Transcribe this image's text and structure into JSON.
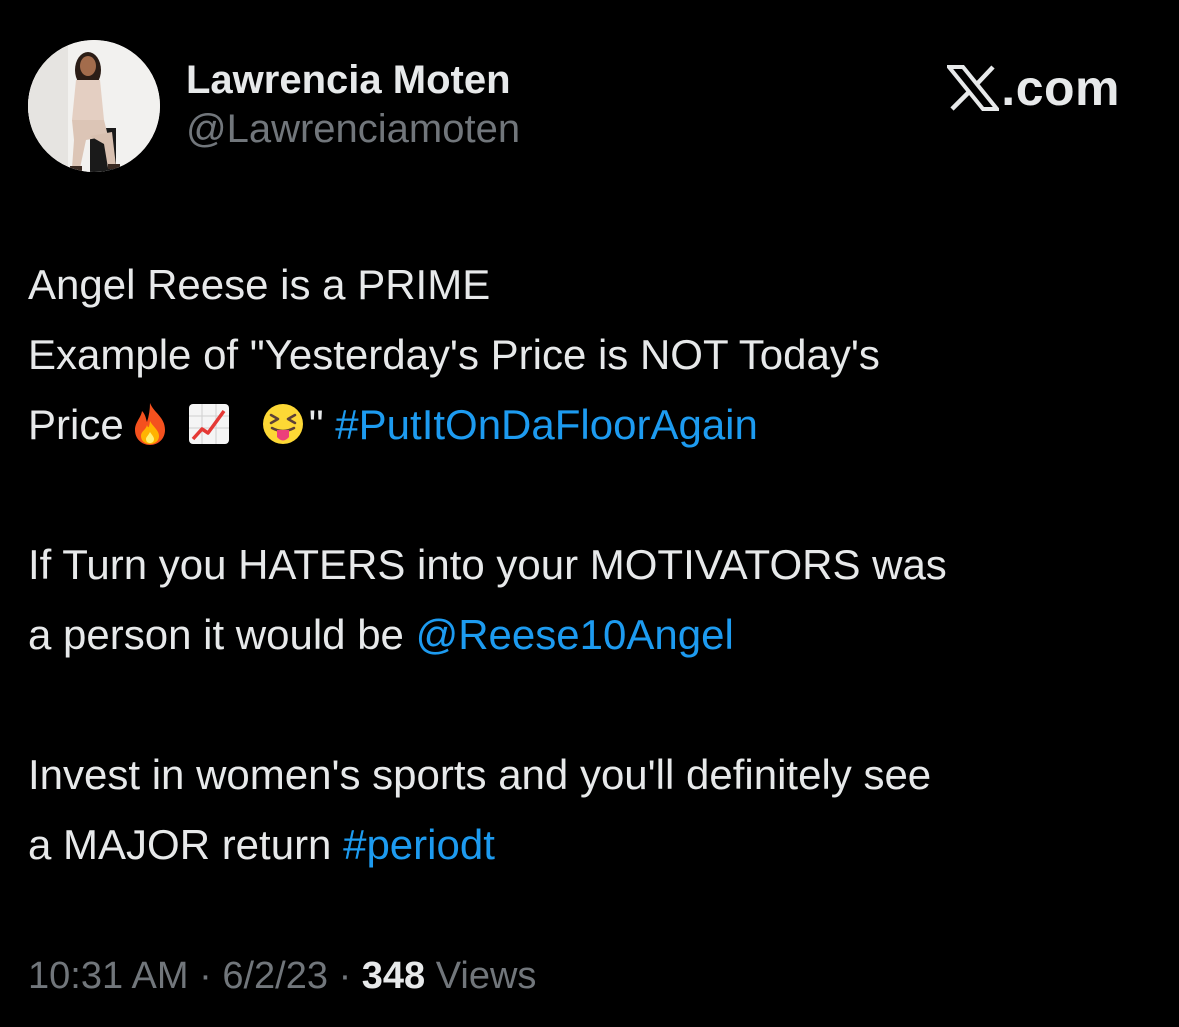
{
  "author": {
    "display_name": "Lawrencia Moten",
    "handle": "@Lawrenciamoten"
  },
  "brand": {
    "icon": "x-logo-icon",
    "label": ".com"
  },
  "tweet": {
    "line1": "Angel Reese is a PRIME",
    "line2": "Example of \"Yesterday's Price is NOT Today's",
    "line3_start": "Price",
    "line3_emojis": [
      "fire-emoji",
      "chart-increasing-emoji",
      "squinting-face-with-tongue-emoji"
    ],
    "line3_quote": "\"",
    "hashtag1": "#PutItOnDaFloorAgain",
    "para2_line1": "If Turn you HATERS into your MOTIVATORS was",
    "para2_line2_start": "a person it would be",
    "mention": "@Reese10Angel",
    "para3_line1": "Invest in women's sports and you'll definitely see",
    "para3_line2_start": "a MAJOR return",
    "hashtag2": "#periodt"
  },
  "footer": {
    "time": "10:31 AM",
    "separator": "·",
    "date": "6/2/23",
    "views_count": "348",
    "views_label": "Views"
  },
  "colors": {
    "background": "#000000",
    "text": "#e7e9ea",
    "secondary": "#71767b",
    "link": "#1d9bf0"
  }
}
